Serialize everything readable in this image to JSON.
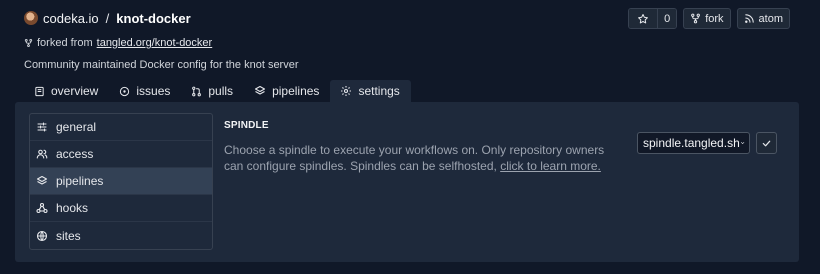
{
  "repo": {
    "owner": "codeka.io",
    "separator": "/",
    "name": "knot-docker",
    "forked_prefix": "forked from",
    "forked_link": "tangled.org/knot-docker",
    "description": "Community maintained Docker config for the knot server"
  },
  "actions": {
    "star_count": "0",
    "fork_label": "fork",
    "atom_label": "atom"
  },
  "tabs": [
    {
      "label": "overview",
      "icon": "book-icon"
    },
    {
      "label": "issues",
      "icon": "circle-dot-icon"
    },
    {
      "label": "pulls",
      "icon": "git-pull-request-icon"
    },
    {
      "label": "pipelines",
      "icon": "layers-icon"
    },
    {
      "label": "settings",
      "icon": "gear-icon",
      "active": true
    }
  ],
  "settings_nav": [
    {
      "label": "general",
      "icon": "sliders-icon"
    },
    {
      "label": "access",
      "icon": "users-icon"
    },
    {
      "label": "pipelines",
      "icon": "layers-icon",
      "active": true
    },
    {
      "label": "hooks",
      "icon": "webhook-icon"
    },
    {
      "label": "sites",
      "icon": "globe-icon"
    }
  ],
  "spindle": {
    "title": "SPINDLE",
    "description": "Choose a spindle to execute your workflows on. Only repository owners can configure spindles. Spindles can be selfhosted,",
    "learn_more": "click to learn more.",
    "selected": "spindle.tangled.sh"
  },
  "colors": {
    "background": "#101828",
    "panel": "#1e293b",
    "active_nav": "#334155"
  }
}
